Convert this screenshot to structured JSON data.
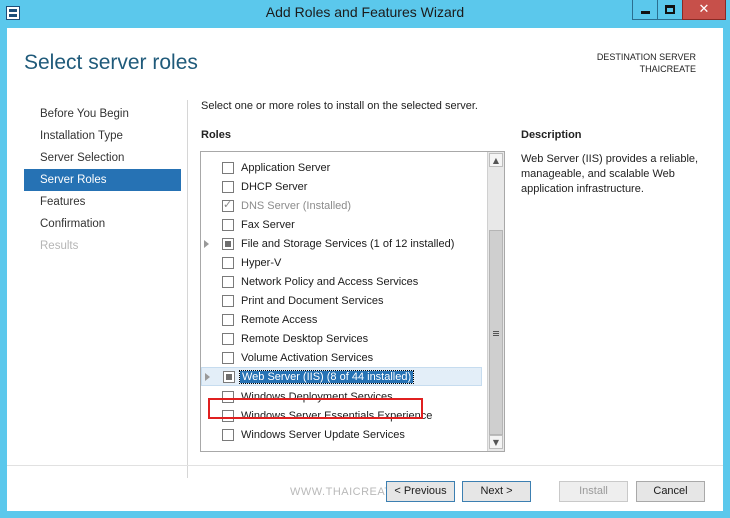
{
  "window": {
    "title": "Add Roles and Features Wizard",
    "close_glyph": "✕"
  },
  "header": {
    "page_title": "Select server roles",
    "destination_label": "DESTINATION SERVER",
    "destination_server": "THAICREATE"
  },
  "nav": {
    "items": [
      {
        "label": "Before You Begin",
        "state": "normal"
      },
      {
        "label": "Installation Type",
        "state": "normal"
      },
      {
        "label": "Server Selection",
        "state": "normal"
      },
      {
        "label": "Server Roles",
        "state": "active"
      },
      {
        "label": "Features",
        "state": "normal"
      },
      {
        "label": "Confirmation",
        "state": "normal"
      },
      {
        "label": "Results",
        "state": "disabled"
      }
    ]
  },
  "main": {
    "instruction": "Select one or more roles to install on the selected server.",
    "roles_header": "Roles",
    "description_header": "Description",
    "description_text": "Web Server (IIS) provides a reliable, manageable, and scalable Web application infrastructure.",
    "roles": [
      {
        "label": "Application Server",
        "check": "none",
        "expander": false
      },
      {
        "label": "DHCP Server",
        "check": "none",
        "expander": false
      },
      {
        "label": "DNS Server (Installed)",
        "check": "checked",
        "expander": false,
        "disabled": true
      },
      {
        "label": "Fax Server",
        "check": "none",
        "expander": false
      },
      {
        "label": "File and Storage Services (1 of 12 installed)",
        "check": "partial",
        "expander": true
      },
      {
        "label": "Hyper-V",
        "check": "none",
        "expander": false
      },
      {
        "label": "Network Policy and Access Services",
        "check": "none",
        "expander": false
      },
      {
        "label": "Print and Document Services",
        "check": "none",
        "expander": false
      },
      {
        "label": "Remote Access",
        "check": "none",
        "expander": false
      },
      {
        "label": "Remote Desktop Services",
        "check": "none",
        "expander": false
      },
      {
        "label": "Volume Activation Services",
        "check": "none",
        "expander": false
      },
      {
        "label": "Web Server (IIS) (8 of 44 installed)",
        "check": "partial",
        "expander": true,
        "selected": true
      },
      {
        "label": "Windows Deployment Services",
        "check": "none",
        "expander": false
      },
      {
        "label": "Windows Server Essentials Experience",
        "check": "none",
        "expander": false
      },
      {
        "label": "Windows Server Update Services",
        "check": "none",
        "expander": false
      }
    ]
  },
  "footer": {
    "watermark": "WWW.THAICREATE",
    "previous_label": "< Previous",
    "next_label": "Next >",
    "install_label": "Install",
    "cancel_label": "Cancel"
  }
}
